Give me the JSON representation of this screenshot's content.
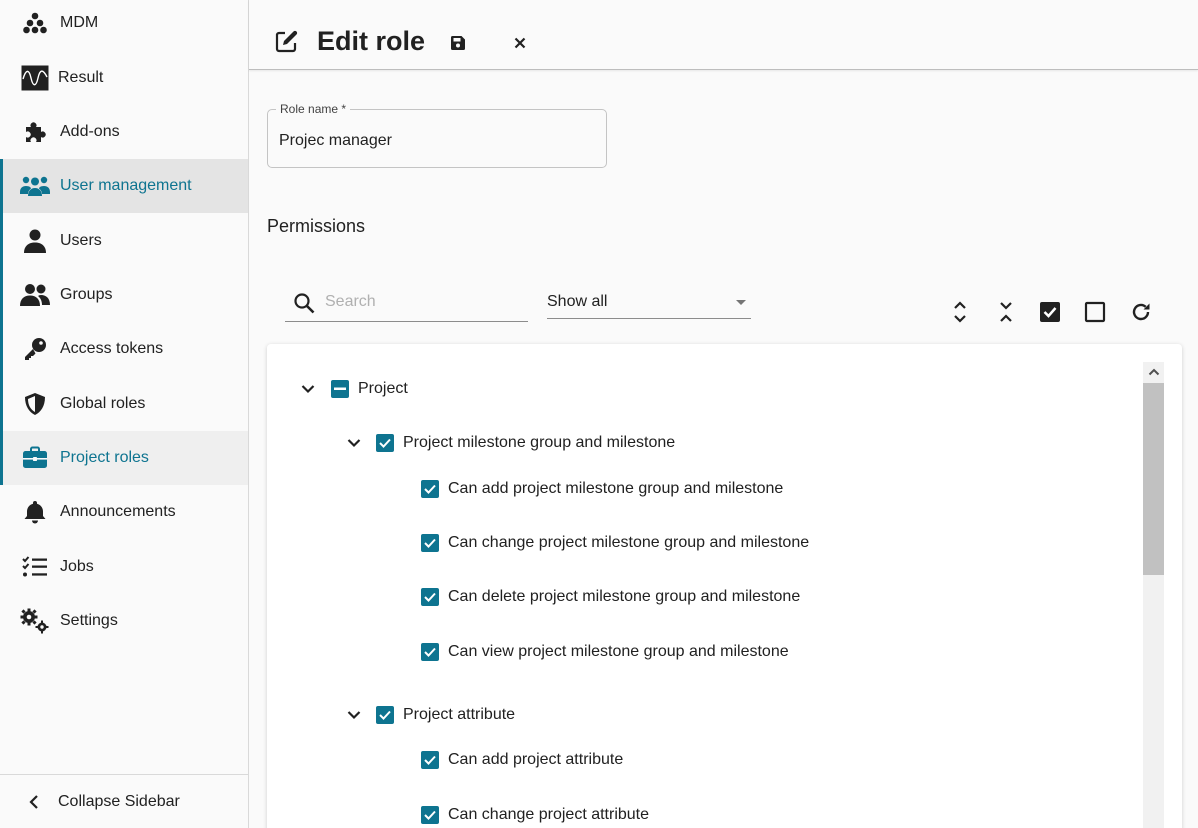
{
  "sidebar": {
    "items": [
      {
        "label": "MDM",
        "icon": "sitemap-icon"
      },
      {
        "label": "Result",
        "icon": "waveform-icon"
      },
      {
        "label": "Add-ons",
        "icon": "puzzle-icon"
      },
      {
        "label": "User management",
        "icon": "users-icon"
      },
      {
        "label": "Users",
        "icon": "user-icon"
      },
      {
        "label": "Groups",
        "icon": "user-group-icon"
      },
      {
        "label": "Access tokens",
        "icon": "key-icon"
      },
      {
        "label": "Global roles",
        "icon": "shield-icon"
      },
      {
        "label": "Project roles",
        "icon": "briefcase-icon"
      },
      {
        "label": "Announcements",
        "icon": "bell-icon"
      },
      {
        "label": "Jobs",
        "icon": "list-check-icon"
      },
      {
        "label": "Settings",
        "icon": "gears-icon"
      }
    ],
    "collapse_label": "Collapse Sidebar",
    "accent_color": "#0e7490"
  },
  "header": {
    "title": "Edit role"
  },
  "form": {
    "role_name_label": "Role name *",
    "role_name_value": "Projec manager"
  },
  "permissions": {
    "title": "Permissions",
    "search_placeholder": "Search",
    "filter_value": "Show all",
    "tree": {
      "root": {
        "label": "Project",
        "state": "indeterminate"
      },
      "groups": [
        {
          "label": "Project milestone group and milestone",
          "state": "checked",
          "children": [
            {
              "label": "Can add project milestone group and milestone",
              "checked": true
            },
            {
              "label": "Can change project milestone group and milestone",
              "checked": true
            },
            {
              "label": "Can delete project milestone group and milestone",
              "checked": true
            },
            {
              "label": "Can view project milestone group and milestone",
              "checked": true
            }
          ]
        },
        {
          "label": "Project attribute",
          "state": "checked",
          "children": [
            {
              "label": "Can add project attribute",
              "checked": true
            },
            {
              "label": "Can change project attribute",
              "checked": true
            }
          ]
        }
      ]
    }
  }
}
